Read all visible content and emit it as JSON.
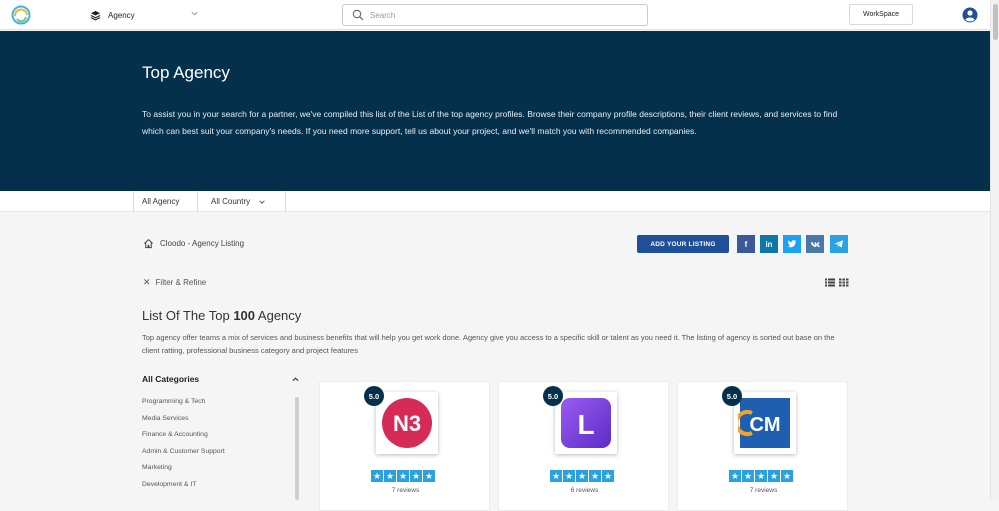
{
  "topbar": {
    "agency_selector": "Agency",
    "search_placeholder": "Search",
    "workspace_label": "WorkSpace"
  },
  "hero": {
    "title": "Top Agency",
    "description": "To assist you in your search for a partner, we've compiled this list of the List of the top agency profiles. Browse their company profile descriptions, their client reviews, and services to find which can best suit your company's needs. If you need more support, tell us about your project, and we'll match you with recommended companies."
  },
  "filters": {
    "all_agency": "All Agency",
    "all_country": "All Country"
  },
  "breadcrumb": {
    "text": "Cloodo - Agency Listing"
  },
  "actions": {
    "add_listing": "ADD YOUR LISTING",
    "filter_refine": "Filter & Refine"
  },
  "social": [
    {
      "name": "facebook",
      "glyph": "f",
      "color": "#3b5998"
    },
    {
      "name": "linkedin",
      "glyph": "in",
      "color": "#0e76a8"
    },
    {
      "name": "twitter",
      "glyph": "t",
      "color": "#1da1f2"
    },
    {
      "name": "vk",
      "glyph": "vk",
      "color": "#4a76a8"
    },
    {
      "name": "telegram",
      "glyph": "tg",
      "color": "#2aa1e0"
    }
  ],
  "listing": {
    "title_prefix": "List Of The Top",
    "title_number": "100",
    "title_suffix": "Agency",
    "description": "Top agency offer teams a mix of services and business benefits that will help you get work done. Agency give you access to a specific skill or talent as you need it. The listing of agency is sorted out base on the client ratting, professional business category and project features"
  },
  "categories": {
    "heading": "All Categories",
    "items": [
      "Programming & Tech",
      "Media Services",
      "Finance & Accounting",
      "Admin & Customer Support",
      "Marketing",
      "Development & IT"
    ]
  },
  "cards": [
    {
      "score": "5.0",
      "logo": "N3",
      "reviews": "7 reviews"
    },
    {
      "score": "5.0",
      "logo": "L",
      "reviews": "6 reviews"
    },
    {
      "score": "5.0",
      "logo": "CM",
      "reviews": "7 reviews"
    }
  ],
  "colors": {
    "hero_bg": "#04304c",
    "primary_button": "#1f4f97",
    "star_bg": "#2aa1e0"
  }
}
